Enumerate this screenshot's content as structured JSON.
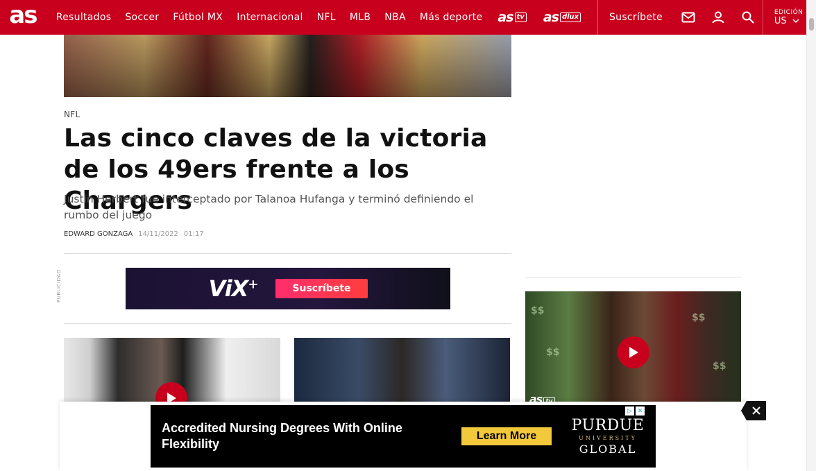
{
  "header": {
    "logo": "as",
    "nav_items": [
      "Resultados",
      "Soccer",
      "Fútbol MX",
      "Internacional",
      "NFL",
      "MLB",
      "NBA",
      "Más deporte"
    ],
    "brand_tv": "as",
    "brand_tv_tag": "tv",
    "brand_deluxe": "as",
    "brand_deluxe_tag": "dlux",
    "subscribe_label": "Suscríbete",
    "edition_label": "EDICIÓN",
    "edition_value": "US",
    "icons": [
      "mail-icon",
      "user-icon",
      "search-icon",
      "chevron-down-icon"
    ],
    "accent_color": "#c9001d"
  },
  "article": {
    "section": "NFL",
    "headline": "Las cinco claves de la victoria de los 49ers frente a los Chargers",
    "summary": "Justin Herbert fue interceptado por Talanoa Hufanga y terminó definiendo el rumbo del juego",
    "author": "EDWARD GONZAGA",
    "date": "14/11/2022",
    "time": "01:17"
  },
  "ad_vix": {
    "publicidad_label": "PUBLICIDAD",
    "logo": "ViX",
    "logo_plus": "+",
    "button": "Suscríbete"
  },
  "sticky_ad": {
    "text": "Accredited Nursing Degrees With Online Flexibility",
    "button": "Learn More",
    "brand_line1": "PURDUE",
    "brand_line2": "UNIVERSITY",
    "brand_line3": "GLOBAL"
  },
  "video_card": {
    "badge": "as",
    "badge_tag": "tv"
  }
}
